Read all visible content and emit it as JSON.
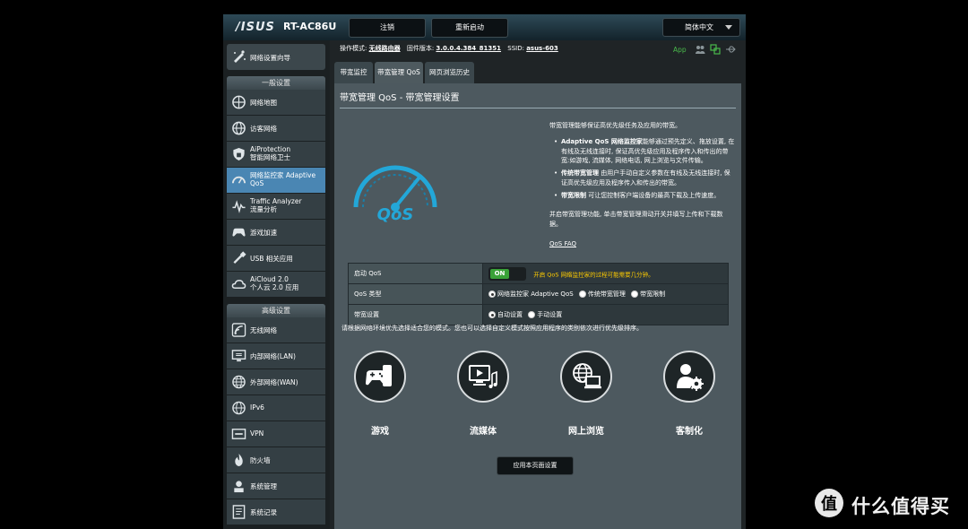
{
  "header": {
    "brand": "/ISUS",
    "model": "RT-AC86U",
    "logout_label": "注销",
    "reboot_label": "重新启动",
    "language": "简体中文"
  },
  "status": {
    "mode_label": "操作模式:",
    "mode_value": "无线路由器",
    "firmware_label": "固件版本:",
    "firmware_value": "3.0.0.4.384_81351",
    "ssid_label": "SSID:",
    "ssid_value": "asus-603",
    "app_label": "App"
  },
  "sidebar": {
    "wizard": "网络设置向导",
    "general_title": "一般设置",
    "general_items": [
      {
        "label": "网络地图",
        "icon": "network-map-icon"
      },
      {
        "label": "访客网络",
        "icon": "guest-network-icon"
      },
      {
        "label": "AiProtection",
        "label2": "智能网络卫士",
        "icon": "aiprotection-icon"
      },
      {
        "label": "网络监控家 Adaptive",
        "label2": "QoS",
        "icon": "qos-speedometer-icon",
        "active": true
      },
      {
        "label": "Traffic Analyzer",
        "label2": "流量分析",
        "icon": "traffic-analyzer-icon"
      },
      {
        "label": "游戏加速",
        "icon": "gamepad-icon"
      },
      {
        "label": "USB 相关应用",
        "icon": "usb-icon"
      },
      {
        "label": "AiCloud 2.0",
        "label2": "个人云 2.0 应用",
        "icon": "cloud-icon"
      }
    ],
    "advanced_title": "高级设置",
    "advanced_items": [
      {
        "label": "无线网络",
        "icon": "wireless-icon"
      },
      {
        "label": "内部网络(LAN)",
        "icon": "lan-icon"
      },
      {
        "label": "外部网络(WAN)",
        "icon": "wan-globe-icon"
      },
      {
        "label": "IPv6",
        "icon": "ipv6-globe-icon"
      },
      {
        "label": "VPN",
        "icon": "vpn-icon"
      },
      {
        "label": "防火墙",
        "icon": "firewall-icon"
      },
      {
        "label": "系统管理",
        "icon": "admin-icon"
      },
      {
        "label": "系统记录",
        "icon": "log-icon"
      }
    ]
  },
  "tabs": [
    "带宽监控",
    "带宽管理 QoS",
    "网页浏览历史"
  ],
  "main": {
    "title": "带宽管理 QoS - 带宽管理设置",
    "intro": "带宽管理能够保证高优先级任务及应用的带宽。",
    "bullets": [
      {
        "bold": "Adaptive QoS 网络监控家",
        "text": "能够通过预先定义、拖放设置, 在有线及无线连接时, 保证高优先级应用及程序传入和传出的带宽:如游戏, 流媒体, 网络电话, 网上浏览与文件传输。"
      },
      {
        "bold": "传统带宽管理",
        "text": " 由用户手动自定义参数在有线及无线连接时, 保证高优先级应用及程序传入和传出的带宽。"
      },
      {
        "bold": "带宽限制",
        "text": " 可让您控制客户端设备的最高下载及上传速度。"
      }
    ],
    "enable_text": "并启带宽管理功能, 单击带宽管理滑动开关并填写上传和下载数据。",
    "faq": "QoS FAQ",
    "qos_logo_text": "QoS"
  },
  "settings": {
    "enable_label": "启动 QoS",
    "toggle_state": "ON",
    "enable_hint": "开启 QoS 网络监控家的过程可能需要几分钟。",
    "type_label": "QoS 类型",
    "type_options": [
      "网络监控家 Adaptive QoS",
      "传统带宽管理",
      "带宽限制"
    ],
    "bandwidth_label": "带宽设置",
    "bandwidth_options": [
      "自动设置",
      "手动设置"
    ]
  },
  "priority_note": "请根据网络环境优先选择适合您的模式。您也可以选择自定义模式按照应用程序的类别依次进行优先级排序。",
  "modes": [
    {
      "label": "游戏",
      "icon": "gaming-icon"
    },
    {
      "label": "流媒体",
      "icon": "media-streaming-icon"
    },
    {
      "label": "网上浏览",
      "icon": "web-surfing-icon"
    },
    {
      "label": "客制化",
      "icon": "customize-icon"
    }
  ],
  "apply_label": "应用本页面设置",
  "watermark": "什么值得买",
  "colors": {
    "active_nav": "#4a86b3",
    "toggle_on": "#3aa238",
    "hint": "#ffcc00",
    "app": "#49b94b"
  }
}
